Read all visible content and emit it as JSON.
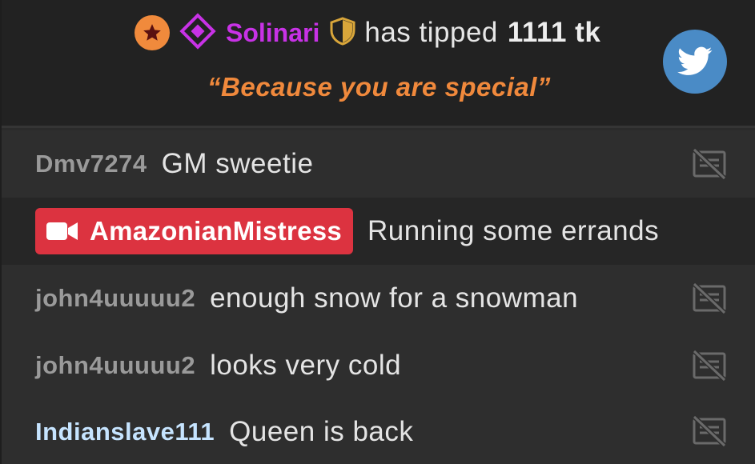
{
  "tip": {
    "tipper": "Solinari",
    "action": "has tipped",
    "amount": "1111 tk",
    "message": "“Because you are special”",
    "colors": {
      "tipper": "#c832e6",
      "star_badge": "#f08a3c",
      "message": "#f0893c"
    }
  },
  "share": {
    "icon": "twitter-icon",
    "color": "#4a8bc6"
  },
  "messages": [
    {
      "user": "Dmv7274",
      "text": "GM sweetie",
      "user_color": "#9a9a9a",
      "icon": "hide-translation-icon"
    },
    {
      "user": "AmazonianMistress",
      "text": "Running some errands",
      "is_host": true,
      "badge_icon": "camera-icon",
      "badge_color": "#dc3340"
    },
    {
      "user": "john4uuuuu2",
      "text": "enough snow for a snowman",
      "user_color": "#9a9a9a",
      "icon": "hide-translation-icon"
    },
    {
      "user": "john4uuuuu2",
      "text": "looks very cold",
      "user_color": "#9a9a9a",
      "icon": "hide-translation-icon"
    },
    {
      "user": "Indianslave111",
      "text": "Queen is back",
      "user_color": "#c6e4ff",
      "icon": "hide-translation-icon"
    }
  ]
}
